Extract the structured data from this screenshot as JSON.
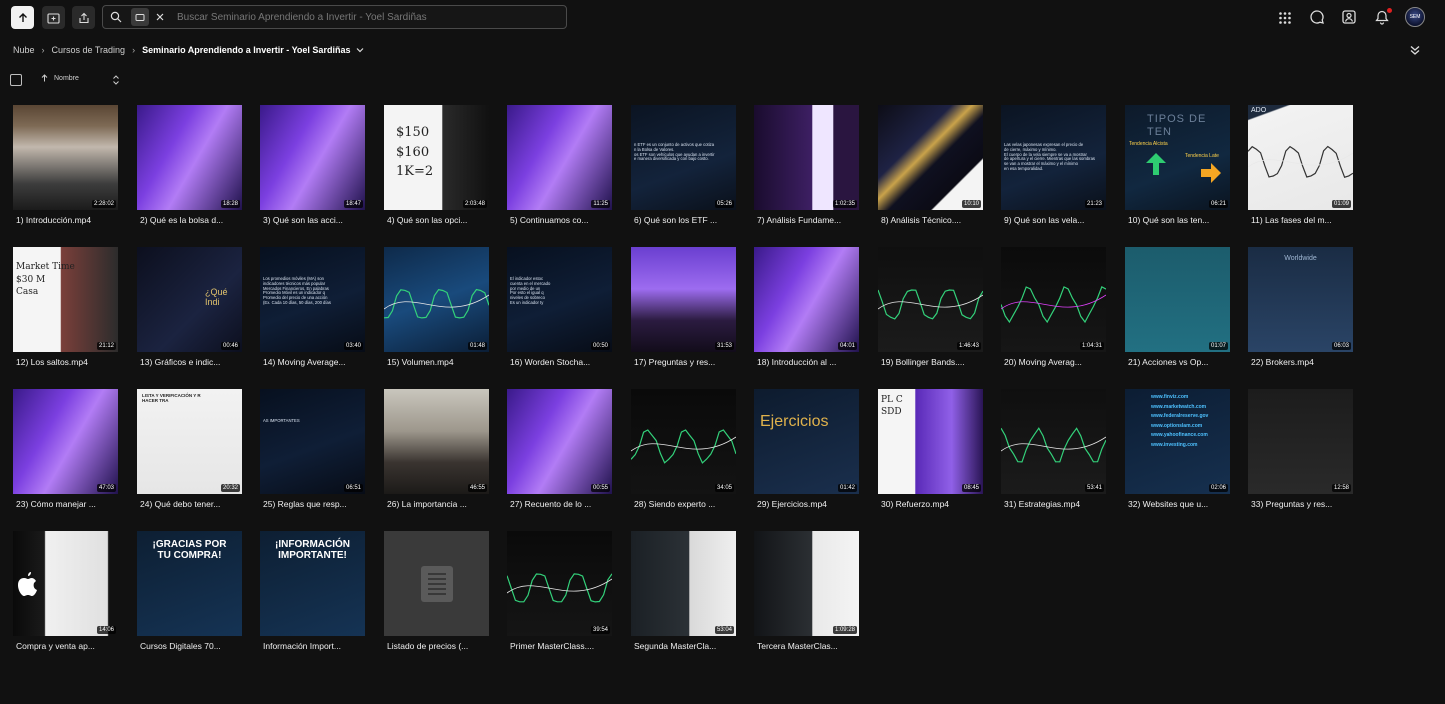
{
  "toolbar": {
    "search_placeholder": "Buscar Seminario Aprendiendo a Invertir - Yoel Sardiñas",
    "icons": [
      "upload-icon",
      "new-folder-icon",
      "share-icon",
      "search-icon",
      "folder-filter-icon",
      "clear-icon"
    ]
  },
  "header_icons": [
    "apps-grid-icon",
    "chat-icon",
    "account-icon",
    "bell-icon"
  ],
  "avatar_label": "SEM",
  "breadcrumb": {
    "items": [
      "Nube",
      "Cursos de Trading"
    ],
    "current": "Seminario Aprendiendo a Invertir - Yoel Sardiñas"
  },
  "sort": {
    "label": "Nombre"
  },
  "colors": {
    "background": "#111111",
    "accent": "#ffffff",
    "notification": "#e02020"
  },
  "files": [
    {
      "name": "1) Introducción.mp4",
      "duration": "2:28:02",
      "theme": "library"
    },
    {
      "name": "2) Qué es la bolsa d...",
      "duration": "18:28",
      "theme": "purple"
    },
    {
      "name": "3) Qué son las acci...",
      "duration": "18:47",
      "theme": "purple"
    },
    {
      "name": "4) Qué son las opci...",
      "duration": "2:03:48",
      "theme": "whiteboard",
      "overlay": "$150\n$160\n1K=2"
    },
    {
      "name": "5) Continuamos co...",
      "duration": "11:25",
      "theme": "purple"
    },
    {
      "name": "6) Qué son los ETF ...",
      "duration": "05:26",
      "theme": "darktext",
      "overlay": "n ETF es un conjunto de activos que cotiza\nn la Bolsa de Valores.\nos ETF son vehículos que ayudan a invertir\ne manera diversificada y con bajo costo."
    },
    {
      "name": "7) Análisis Fundame...",
      "duration": "1:02:35",
      "theme": "purpledark"
    },
    {
      "name": "8) Análisis Técnico....",
      "duration": "10:10",
      "theme": "gold"
    },
    {
      "name": "9) Qué son las vela...",
      "duration": "21:23",
      "theme": "darktext",
      "overlay": "Las velas japonesas expresan el precio de\nde cierre, máximo y mínimo.\nEl cuerpo de la vela siempre se va a mostrar\nde apertura y el cierre. Mientras que las sombras\nse van a mostrar el máximo y el mínimo\nen esa temporalidad."
    },
    {
      "name": "10) Qué son las ten...",
      "duration": "06:21",
      "theme": "tendencia",
      "overlay": "TIPOS DE TEN"
    },
    {
      "name": "11) Las fases del m...",
      "duration": "01:09",
      "theme": "chartwhite",
      "overlay": "ADO"
    },
    {
      "name": "12) Los saltos.mp4",
      "duration": "21:12",
      "theme": "whiteboard2",
      "overlay": "Market Time\n$30 M\nCasa"
    },
    {
      "name": "13) Gráficos e indic...",
      "duration": "00:46",
      "theme": "goldblocks",
      "overlay": "¿Qué\nIndi"
    },
    {
      "name": "14) Moving Average...",
      "duration": "03:40",
      "theme": "darktext2",
      "overlay": "Los promedios móviles (MA) son\nindicadores técnicos más popular\nMercados Financieros. En palabras\nPromedio Móvil es un indicador q\nPromedio del precio de una acción\n(Ex. Cada 10 días, 50 días, 200 días"
    },
    {
      "name": "15) Volumen.mp4",
      "duration": "01:48",
      "theme": "bluechart"
    },
    {
      "name": "16) Worden Stocha...",
      "duration": "00:50",
      "theme": "darktext2",
      "overlay": "El indicador estoc\ncuenta en el mercado\npor medio de un\nPor esto el igual q\nniveles de sobreco\nEs un indicador ty"
    },
    {
      "name": "17) Preguntas y res...",
      "duration": "31:53",
      "theme": "audience"
    },
    {
      "name": "18) Introducción al ...",
      "duration": "04:01",
      "theme": "purple"
    },
    {
      "name": "19) Bollinger Bands....",
      "duration": "1:46:43",
      "theme": "bollinger"
    },
    {
      "name": "20) Moving Averag...",
      "duration": "1:04:31",
      "theme": "mavg"
    },
    {
      "name": "21) Acciones vs Op...",
      "duration": "01:07",
      "theme": "table"
    },
    {
      "name": "22) Brokers.mp4",
      "duration": "06:03",
      "theme": "brokers",
      "overlay": "Worldwide"
    },
    {
      "name": "23) Cómo manejar ...",
      "duration": "47:03",
      "theme": "purple"
    },
    {
      "name": "24) Qué debo tener...",
      "duration": "20:32",
      "theme": "checklist",
      "overlay": "LISTA Y VERIFICACIÓN Y R\nHACER TRA"
    },
    {
      "name": "25) Reglas que resp...",
      "duration": "06:51",
      "theme": "darktext2",
      "overlay": "AS IMPORTANTES"
    },
    {
      "name": "26) La importancia ...",
      "duration": "46:55",
      "theme": "webcam"
    },
    {
      "name": "27) Recuento de lo ...",
      "duration": "00:55",
      "theme": "purple"
    },
    {
      "name": "28) Siendo experto ...",
      "duration": "34:05",
      "theme": "platform"
    },
    {
      "name": "29) Ejercicios.mp4",
      "duration": "01:42",
      "theme": "ejercicios",
      "overlay": "Ejercicios"
    },
    {
      "name": "30) Refuerzo.mp4",
      "duration": "08:45",
      "theme": "whiteboardpurple",
      "overlay": "PL C\nSDD"
    },
    {
      "name": "31) Estrategias.mp4",
      "duration": "53:41",
      "theme": "bollinger"
    },
    {
      "name": "32) Websites que u...",
      "duration": "02:06",
      "theme": "websites",
      "overlay": "www.finviz.com\nwww.marketwatch.com\nwww.federalreserve.gov\nwww.optionslam.com\nwww.yahoofinance.com\nwww.investing.com"
    },
    {
      "name": "33) Preguntas y res...",
      "duration": "12:58",
      "theme": "zoom"
    },
    {
      "name": "Compra y venta ap...",
      "duration": "14:06",
      "theme": "apple"
    },
    {
      "name": "Cursos Digitales 70...",
      "duration": "",
      "theme": "gracias",
      "overlay": "¡GRACIAS POR\nTU COMPRA!"
    },
    {
      "name": "Información Import...",
      "duration": "",
      "theme": "info",
      "overlay": "¡INFORMACIÓN\nIMPORTANTE!"
    },
    {
      "name": "Listado de precios (...",
      "duration": "",
      "theme": "doc"
    },
    {
      "name": "Primer MasterClass....",
      "duration": "39:54",
      "theme": "platform2"
    },
    {
      "name": "Segunda MasterCla...",
      "duration": "53:04",
      "theme": "teacher"
    },
    {
      "name": "Tercera MasterClas...",
      "duration": "1:09:28",
      "theme": "teacher2"
    }
  ]
}
